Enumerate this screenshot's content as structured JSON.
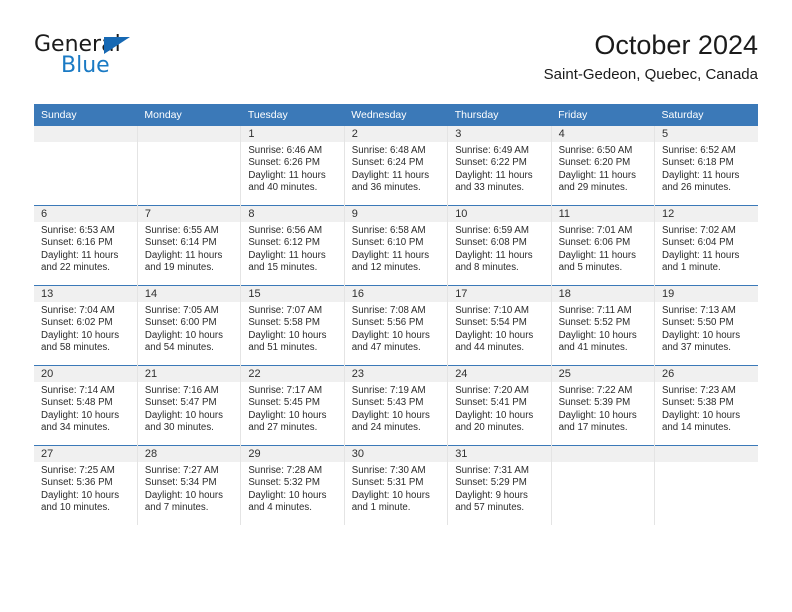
{
  "logo": {
    "word_top": "General",
    "word_bottom": "Blue",
    "triangle_color": "#1668b3",
    "blue_text_color": "#1a7ac4"
  },
  "header": {
    "title": "October 2024",
    "subtitle": "Saint-Gedeon, Quebec, Canada",
    "accent_color": "#3b79b8",
    "band_color": "#f0f0f0"
  },
  "weekday_headers": [
    "Sunday",
    "Monday",
    "Tuesday",
    "Wednesday",
    "Thursday",
    "Friday",
    "Saturday"
  ],
  "weeks": [
    [
      {
        "day": "",
        "lines": []
      },
      {
        "day": "",
        "lines": []
      },
      {
        "day": "1",
        "lines": [
          "Sunrise: 6:46 AM",
          "Sunset: 6:26 PM",
          "Daylight: 11 hours",
          "and 40 minutes."
        ]
      },
      {
        "day": "2",
        "lines": [
          "Sunrise: 6:48 AM",
          "Sunset: 6:24 PM",
          "Daylight: 11 hours",
          "and 36 minutes."
        ]
      },
      {
        "day": "3",
        "lines": [
          "Sunrise: 6:49 AM",
          "Sunset: 6:22 PM",
          "Daylight: 11 hours",
          "and 33 minutes."
        ]
      },
      {
        "day": "4",
        "lines": [
          "Sunrise: 6:50 AM",
          "Sunset: 6:20 PM",
          "Daylight: 11 hours",
          "and 29 minutes."
        ]
      },
      {
        "day": "5",
        "lines": [
          "Sunrise: 6:52 AM",
          "Sunset: 6:18 PM",
          "Daylight: 11 hours",
          "and 26 minutes."
        ]
      }
    ],
    [
      {
        "day": "6",
        "lines": [
          "Sunrise: 6:53 AM",
          "Sunset: 6:16 PM",
          "Daylight: 11 hours",
          "and 22 minutes."
        ]
      },
      {
        "day": "7",
        "lines": [
          "Sunrise: 6:55 AM",
          "Sunset: 6:14 PM",
          "Daylight: 11 hours",
          "and 19 minutes."
        ]
      },
      {
        "day": "8",
        "lines": [
          "Sunrise: 6:56 AM",
          "Sunset: 6:12 PM",
          "Daylight: 11 hours",
          "and 15 minutes."
        ]
      },
      {
        "day": "9",
        "lines": [
          "Sunrise: 6:58 AM",
          "Sunset: 6:10 PM",
          "Daylight: 11 hours",
          "and 12 minutes."
        ]
      },
      {
        "day": "10",
        "lines": [
          "Sunrise: 6:59 AM",
          "Sunset: 6:08 PM",
          "Daylight: 11 hours",
          "and 8 minutes."
        ]
      },
      {
        "day": "11",
        "lines": [
          "Sunrise: 7:01 AM",
          "Sunset: 6:06 PM",
          "Daylight: 11 hours",
          "and 5 minutes."
        ]
      },
      {
        "day": "12",
        "lines": [
          "Sunrise: 7:02 AM",
          "Sunset: 6:04 PM",
          "Daylight: 11 hours",
          "and 1 minute."
        ]
      }
    ],
    [
      {
        "day": "13",
        "lines": [
          "Sunrise: 7:04 AM",
          "Sunset: 6:02 PM",
          "Daylight: 10 hours",
          "and 58 minutes."
        ]
      },
      {
        "day": "14",
        "lines": [
          "Sunrise: 7:05 AM",
          "Sunset: 6:00 PM",
          "Daylight: 10 hours",
          "and 54 minutes."
        ]
      },
      {
        "day": "15",
        "lines": [
          "Sunrise: 7:07 AM",
          "Sunset: 5:58 PM",
          "Daylight: 10 hours",
          "and 51 minutes."
        ]
      },
      {
        "day": "16",
        "lines": [
          "Sunrise: 7:08 AM",
          "Sunset: 5:56 PM",
          "Daylight: 10 hours",
          "and 47 minutes."
        ]
      },
      {
        "day": "17",
        "lines": [
          "Sunrise: 7:10 AM",
          "Sunset: 5:54 PM",
          "Daylight: 10 hours",
          "and 44 minutes."
        ]
      },
      {
        "day": "18",
        "lines": [
          "Sunrise: 7:11 AM",
          "Sunset: 5:52 PM",
          "Daylight: 10 hours",
          "and 41 minutes."
        ]
      },
      {
        "day": "19",
        "lines": [
          "Sunrise: 7:13 AM",
          "Sunset: 5:50 PM",
          "Daylight: 10 hours",
          "and 37 minutes."
        ]
      }
    ],
    [
      {
        "day": "20",
        "lines": [
          "Sunrise: 7:14 AM",
          "Sunset: 5:48 PM",
          "Daylight: 10 hours",
          "and 34 minutes."
        ]
      },
      {
        "day": "21",
        "lines": [
          "Sunrise: 7:16 AM",
          "Sunset: 5:47 PM",
          "Daylight: 10 hours",
          "and 30 minutes."
        ]
      },
      {
        "day": "22",
        "lines": [
          "Sunrise: 7:17 AM",
          "Sunset: 5:45 PM",
          "Daylight: 10 hours",
          "and 27 minutes."
        ]
      },
      {
        "day": "23",
        "lines": [
          "Sunrise: 7:19 AM",
          "Sunset: 5:43 PM",
          "Daylight: 10 hours",
          "and 24 minutes."
        ]
      },
      {
        "day": "24",
        "lines": [
          "Sunrise: 7:20 AM",
          "Sunset: 5:41 PM",
          "Daylight: 10 hours",
          "and 20 minutes."
        ]
      },
      {
        "day": "25",
        "lines": [
          "Sunrise: 7:22 AM",
          "Sunset: 5:39 PM",
          "Daylight: 10 hours",
          "and 17 minutes."
        ]
      },
      {
        "day": "26",
        "lines": [
          "Sunrise: 7:23 AM",
          "Sunset: 5:38 PM",
          "Daylight: 10 hours",
          "and 14 minutes."
        ]
      }
    ],
    [
      {
        "day": "27",
        "lines": [
          "Sunrise: 7:25 AM",
          "Sunset: 5:36 PM",
          "Daylight: 10 hours",
          "and 10 minutes."
        ]
      },
      {
        "day": "28",
        "lines": [
          "Sunrise: 7:27 AM",
          "Sunset: 5:34 PM",
          "Daylight: 10 hours",
          "and 7 minutes."
        ]
      },
      {
        "day": "29",
        "lines": [
          "Sunrise: 7:28 AM",
          "Sunset: 5:32 PM",
          "Daylight: 10 hours",
          "and 4 minutes."
        ]
      },
      {
        "day": "30",
        "lines": [
          "Sunrise: 7:30 AM",
          "Sunset: 5:31 PM",
          "Daylight: 10 hours",
          "and 1 minute."
        ]
      },
      {
        "day": "31",
        "lines": [
          "Sunrise: 7:31 AM",
          "Sunset: 5:29 PM",
          "Daylight: 9 hours",
          "and 57 minutes."
        ]
      },
      {
        "day": "",
        "lines": []
      },
      {
        "day": "",
        "lines": []
      }
    ]
  ]
}
